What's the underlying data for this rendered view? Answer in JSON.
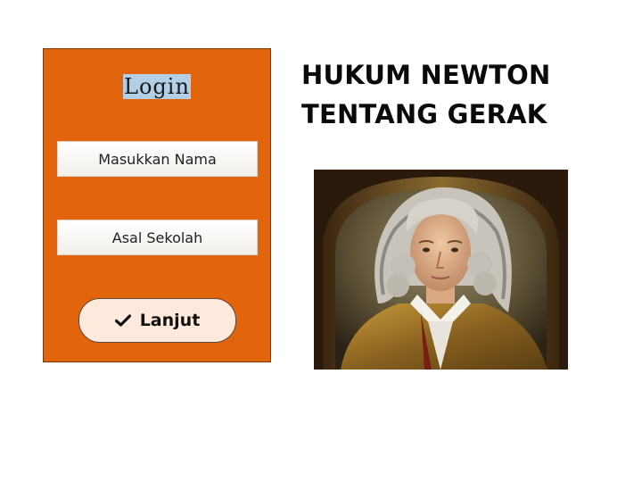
{
  "login": {
    "title": "Login",
    "name_placeholder": "Masukkan Nama",
    "school_placeholder": "Asal Sekolah",
    "continue_label": "Lanjut",
    "continue_icon": "check-icon"
  },
  "header": {
    "title_line1": "HUKUM NEWTON",
    "title_line2": "TENTANG GERAK"
  },
  "colors": {
    "panel": "#e2650e",
    "button": "#fdeadd",
    "title_highlight": "#b3cfe8"
  }
}
